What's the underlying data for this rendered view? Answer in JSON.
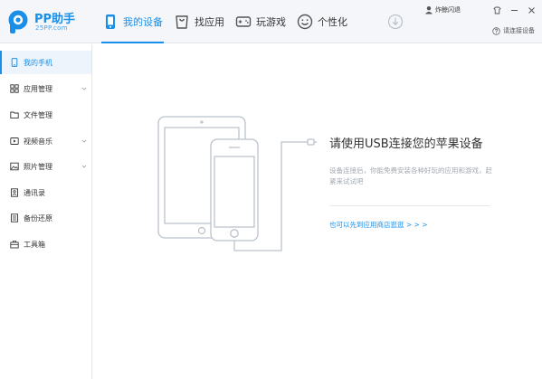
{
  "app": {
    "logo_name": "PP助手",
    "logo_sub": "25PP.com"
  },
  "nav": {
    "tabs": [
      {
        "label": "我的设备",
        "icon": "device-icon",
        "active": true
      },
      {
        "label": "找应用",
        "icon": "shopping-bag-icon",
        "active": false
      },
      {
        "label": "玩游戏",
        "icon": "gamepad-icon",
        "active": false
      },
      {
        "label": "个性化",
        "icon": "smiley-icon",
        "active": false
      }
    ],
    "download_icon": "download-icon"
  },
  "user": {
    "name": "炸鲸闪退",
    "icon": "user-icon"
  },
  "window": {
    "buttons": [
      "skin-icon",
      "minimize-icon",
      "close-icon"
    ]
  },
  "help": {
    "label": "请连接设备",
    "icon": "help-icon"
  },
  "sidebar": {
    "items": [
      {
        "label": "我的手机",
        "icon": "phone-icon",
        "active": true,
        "expandable": false
      },
      {
        "label": "应用管理",
        "icon": "apps-grid-icon",
        "active": false,
        "expandable": true
      },
      {
        "label": "文件管理",
        "icon": "folder-icon",
        "active": false,
        "expandable": false
      },
      {
        "label": "视频音乐",
        "icon": "video-icon",
        "active": false,
        "expandable": true
      },
      {
        "label": "照片管理",
        "icon": "image-icon",
        "active": false,
        "expandable": true
      },
      {
        "label": "通讯录",
        "icon": "contacts-icon",
        "active": false,
        "expandable": false
      },
      {
        "label": "备份还原",
        "icon": "backup-icon",
        "active": false,
        "expandable": false
      },
      {
        "label": "工具箱",
        "icon": "toolbox-icon",
        "active": false,
        "expandable": false
      }
    ]
  },
  "main": {
    "title": "请使用USB连接您的苹果设备",
    "description": "设备连接后，你能免费安装各种好玩的应用和游戏，赶紧来试试吧",
    "link": "也可以先到应用商店逛逛 > > >"
  },
  "colors": {
    "accent": "#1a8fe8",
    "header_bg": "#f4f6f9",
    "muted_text": "#a2a8b0",
    "illustration_stroke": "#b9c2cc"
  }
}
